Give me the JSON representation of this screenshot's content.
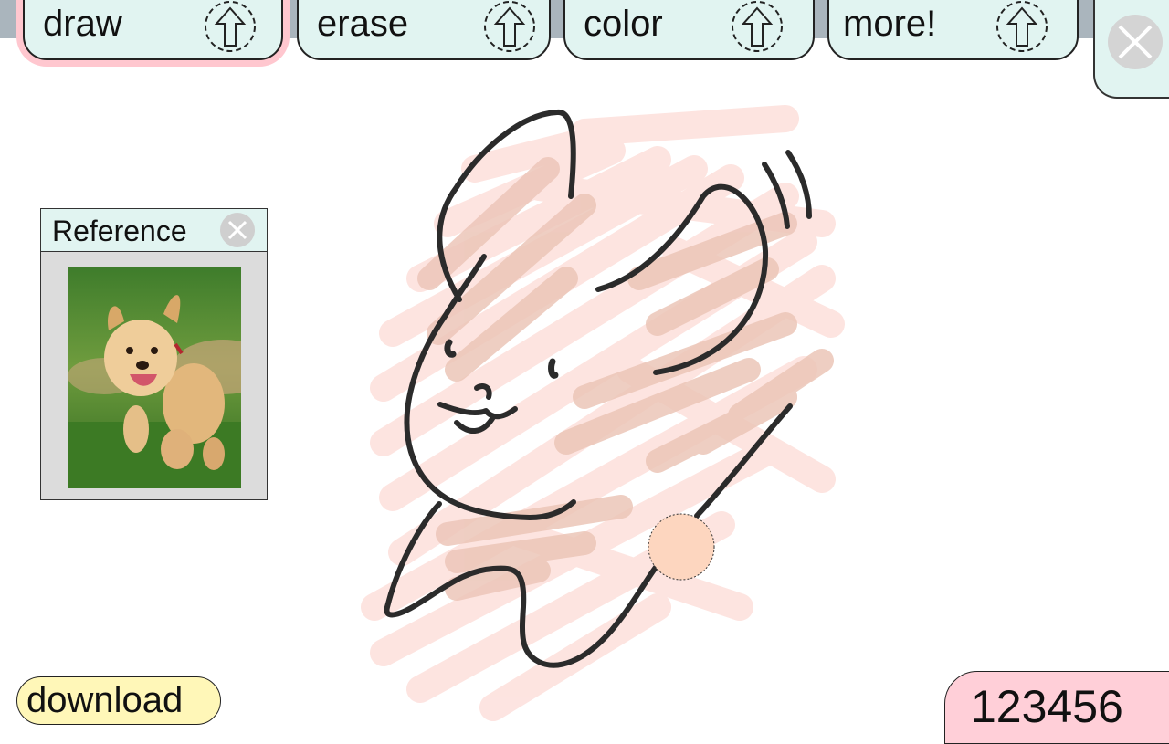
{
  "toolbar": {
    "tabs": [
      {
        "label": "draw",
        "active": true
      },
      {
        "label": "erase",
        "active": false
      },
      {
        "label": "color",
        "active": false
      },
      {
        "label": "more!",
        "active": false
      }
    ],
    "tab_icon": "up-arrow-icon",
    "close_icon": "close-icon"
  },
  "reference": {
    "title": "Reference",
    "close_icon": "close-icon",
    "image": "puppy-photo"
  },
  "download": {
    "label": "download"
  },
  "score": {
    "value": "123456"
  },
  "colors": {
    "tab_bg": "#e1f4f1",
    "active_glow": "#ffc7cf",
    "brush_light": "#fde3df",
    "brush_dark": "#ecc6b8",
    "current_color": "#fdd6bf",
    "download_bg": "#fff7b8",
    "score_bg": "#ffcfd8"
  }
}
